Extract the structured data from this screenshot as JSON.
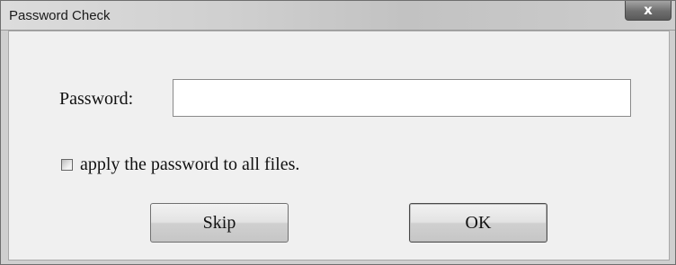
{
  "window": {
    "title": "Password Check",
    "close_label": "x"
  },
  "form": {
    "password_label": "Password:",
    "password_value": "",
    "apply_all_label": "apply the password to all files.",
    "apply_all_checked": false
  },
  "buttons": {
    "skip_label": "Skip",
    "ok_label": "OK"
  }
}
